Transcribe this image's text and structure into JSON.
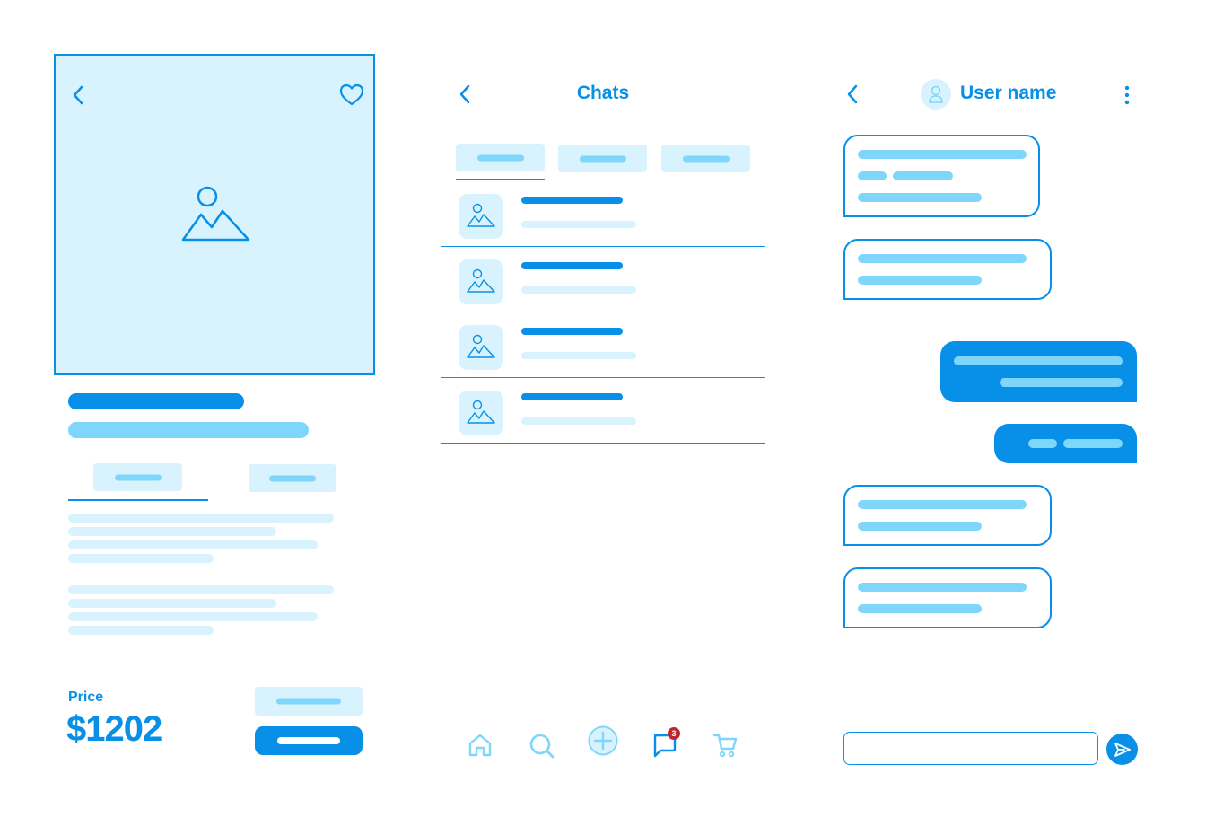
{
  "product": {
    "price_label": "Price",
    "price_value": "$1202"
  },
  "chats_screen": {
    "title": "Chats",
    "nav_badge_count": "3",
    "nav_icons": [
      "home-icon",
      "search-icon",
      "add-icon",
      "chat-icon",
      "cart-icon"
    ]
  },
  "chat_detail": {
    "user_name": "User name"
  },
  "colors": {
    "primary": "#0890e8",
    "mid": "#7fd6fb",
    "light": "#d8f3fd",
    "badge": "#c0262d"
  }
}
